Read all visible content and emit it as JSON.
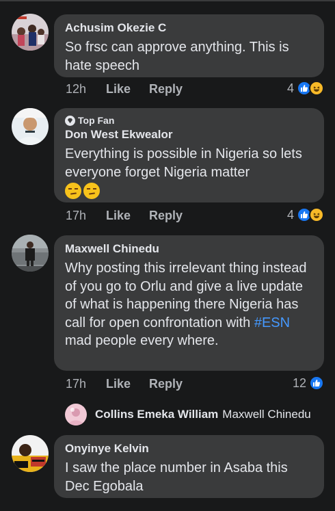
{
  "comments": [
    {
      "name": "Achusim Okezie C",
      "text": "So frsc can approve anything. This is hate speech",
      "time": "12h",
      "like_label": "Like",
      "reply_label": "Reply",
      "reaction_count": "4",
      "reactions": [
        "like-icon",
        "haha-icon"
      ]
    },
    {
      "badge": "Top Fan",
      "name": "Don West Ekwealor",
      "text": "Everything is possible in Nigeria so lets everyone forget Nigeria matter",
      "emojis": [
        "smirk-emoji",
        "smirk-emoji"
      ],
      "time": "17h",
      "like_label": "Like",
      "reply_label": "Reply",
      "reaction_count": "4",
      "reactions": [
        "like-icon",
        "haha-icon"
      ]
    },
    {
      "name": "Maxwell Chinedu",
      "text_before": "Why posting this irrelevant thing instead of you go to Orlu and give a live update of what is happening there Nigeria has call for open confrontation with ",
      "hashtag": "#ESN",
      "text_after": " mad people every where.",
      "time": "17h",
      "like_label": "Like",
      "reply_label": "Reply",
      "reaction_count": "12",
      "reactions": [
        "like-icon"
      ]
    },
    {
      "name": "Onyinye Kelvin",
      "text": "I saw the place number in Asaba this Dec Egobala"
    }
  ],
  "reply_preview": {
    "name": "Collins Emeka William",
    "snippet": "Maxwell Chinedu"
  },
  "colors": {
    "background": "#18191a",
    "bubble": "#3a3b3c",
    "like_blue": "#1877f2",
    "haha_yellow": "#f7b928",
    "hashtag": "#4599ff"
  }
}
